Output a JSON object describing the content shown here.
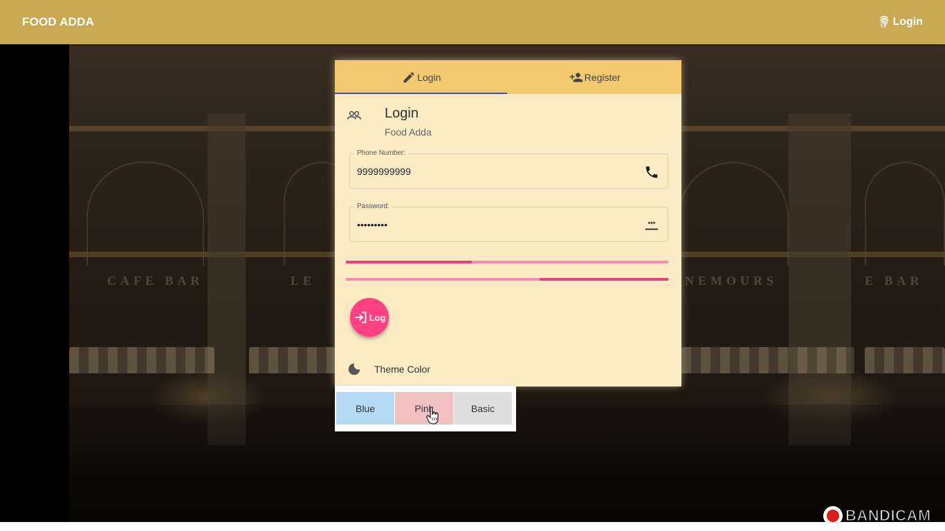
{
  "app": {
    "brand": "FOOD ADDA",
    "top_login": "Login"
  },
  "background": {
    "signs": [
      "CAFE BAR",
      "LE",
      "NEMOURS",
      "E BAR"
    ]
  },
  "tabs": [
    {
      "label": "Login",
      "icon": "pencil-icon",
      "active": true
    },
    {
      "label": "Register",
      "icon": "person-add-icon",
      "active": false
    }
  ],
  "card": {
    "title": "Login",
    "subtitle": "Food Adda"
  },
  "phone": {
    "label": "Phone Number:",
    "value": "9999999999"
  },
  "password": {
    "label": "Password:",
    "value": "•••••••••"
  },
  "progress": [
    {
      "value": 0.39
    },
    {
      "value": 0.4
    }
  ],
  "login_button": {
    "label": "Log"
  },
  "theme": {
    "label": "Theme Color",
    "options": [
      "Blue",
      "Pink",
      "Basic"
    ]
  },
  "watermark": {
    "text": "BANDICAM"
  },
  "colors": {
    "topbar": "#c8a851",
    "tabs": "#f2c96e",
    "card": "#fbecc6",
    "accent": "#ff4081",
    "ink": "#3f51b5"
  }
}
